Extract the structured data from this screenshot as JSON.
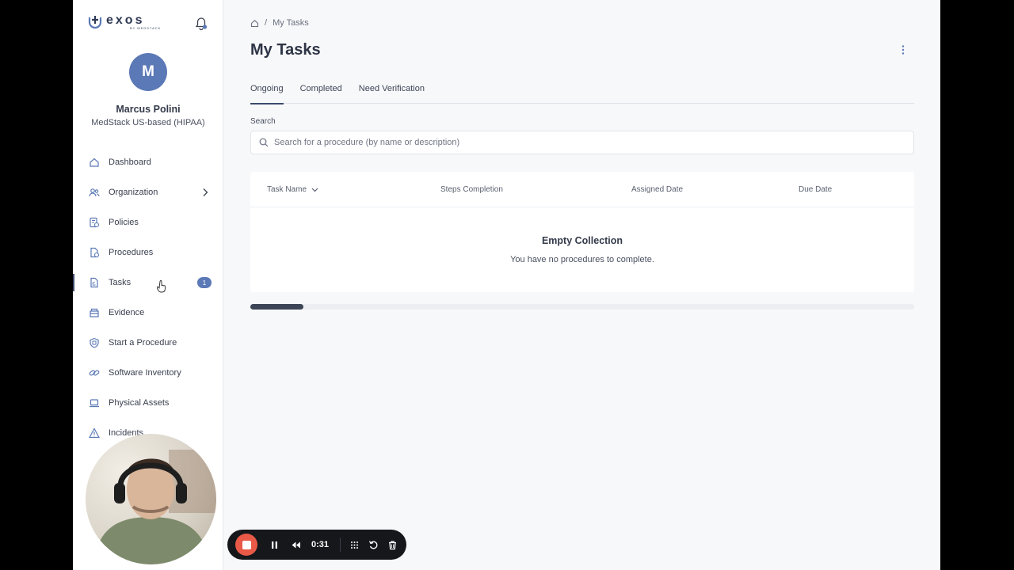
{
  "brand": {
    "name": "exos",
    "sub": "BY MEDSTACK"
  },
  "user": {
    "initial": "M",
    "name": "Marcus Polini",
    "org": "MedStack US-based (HIPAA)"
  },
  "nav": [
    {
      "label": "Dashboard",
      "icon": "home-icon"
    },
    {
      "label": "Organization",
      "icon": "users-icon"
    },
    {
      "label": "Policies",
      "icon": "policy-icon"
    },
    {
      "label": "Procedures",
      "icon": "procedure-icon"
    },
    {
      "label": "Tasks",
      "icon": "tasks-icon",
      "badge": "1"
    },
    {
      "label": "Evidence",
      "icon": "evidence-icon"
    },
    {
      "label": "Start a Procedure",
      "icon": "shield-icon"
    },
    {
      "label": "Software Inventory",
      "icon": "link-icon"
    },
    {
      "label": "Physical Assets",
      "icon": "laptop-icon"
    },
    {
      "label": "Incidents",
      "icon": "warning-icon"
    }
  ],
  "breadcrumb": {
    "separator": "/",
    "current": "My Tasks"
  },
  "page": {
    "title": "My Tasks"
  },
  "tabs": [
    {
      "label": "Ongoing",
      "active": true
    },
    {
      "label": "Completed"
    },
    {
      "label": "Need Verification"
    }
  ],
  "search": {
    "label": "Search",
    "placeholder": "Search for a procedure (by name or description)"
  },
  "table": {
    "columns": [
      "Task Name",
      "Steps Completion",
      "Assigned Date",
      "Due Date"
    ],
    "empty_title": "Empty Collection",
    "empty_message": "You have no procedures to complete."
  },
  "progress": {
    "fraction": 0.08
  },
  "recorder": {
    "time": "0:31"
  },
  "colors": {
    "accent": "#5b79b6",
    "active": "#3c4a6b",
    "record": "#e85a47"
  }
}
